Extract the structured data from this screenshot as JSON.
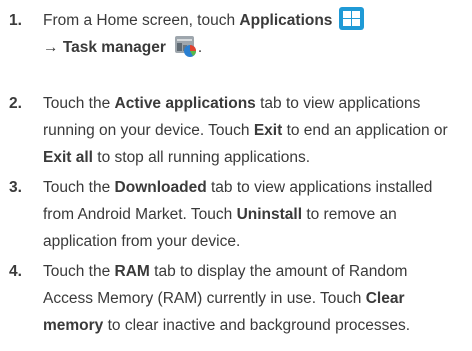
{
  "steps": [
    {
      "number": "1.",
      "line1": {
        "before": "From a Home screen, touch ",
        "bold": "Applications"
      },
      "line2": {
        "arrow": "→",
        "bold": "Task manager",
        "after": "."
      }
    },
    {
      "number": "2.",
      "lines": [
        [
          "Touch the ",
          {
            "b": "Active applications"
          },
          " tab to view applications"
        ],
        [
          "running on your device. Touch ",
          {
            "b": "Exit"
          },
          " to end an application or"
        ],
        [
          {
            "b": "Exit all"
          },
          " to stop all running applications."
        ]
      ]
    },
    {
      "number": "3.",
      "lines": [
        [
          "Touch the ",
          {
            "b": "Downloaded"
          },
          " tab to view applications installed"
        ],
        [
          "from Android Market. Touch ",
          {
            "b": "Uninstall"
          },
          " to remove an"
        ],
        [
          "application from your device."
        ]
      ]
    },
    {
      "number": "4.",
      "lines": [
        [
          "Touch the ",
          {
            "b": "RAM"
          },
          " tab to display the amount of Random"
        ],
        [
          "Access Memory (RAM) currently in use. Touch ",
          {
            "b": "Clear"
          }
        ],
        [
          {
            "b": "memory"
          },
          " to clear inactive and background processes."
        ]
      ]
    }
  ],
  "icons": {
    "applications": "applications-grid-icon",
    "task_manager": "task-manager-icon"
  },
  "colors": {
    "applications_icon": "#1f9ad6"
  }
}
